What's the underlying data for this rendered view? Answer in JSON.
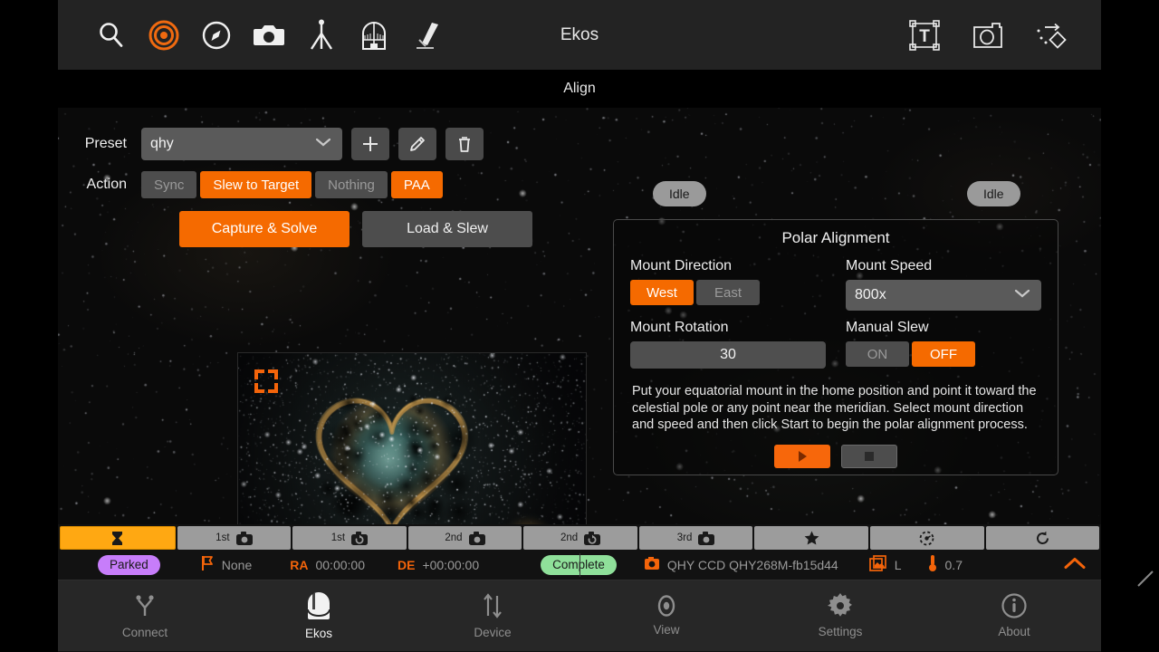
{
  "app": {
    "title": "Ekos",
    "page_title": "Align"
  },
  "toolbar": {
    "left_icons": [
      {
        "name": "search-icon",
        "label": "Search"
      },
      {
        "name": "target-icon",
        "label": "Target"
      },
      {
        "name": "compass-icon",
        "label": "Compass"
      },
      {
        "name": "camera-icon",
        "label": "Camera"
      },
      {
        "name": "tripod-icon",
        "label": "Mount"
      },
      {
        "name": "observatory-dome-icon",
        "label": "Observatory"
      },
      {
        "name": "telescope-icon",
        "label": "Telescope"
      }
    ],
    "right_icons": [
      {
        "name": "text-frame-icon",
        "label": "Text Overlay"
      },
      {
        "name": "photo-frame-icon",
        "label": "Photo"
      },
      {
        "name": "motion-diamond-icon",
        "label": "Motion"
      }
    ]
  },
  "align": {
    "preset_label": "Preset",
    "preset_value": "qhy",
    "preset_add_label": "+",
    "preset_edit_label": "Edit",
    "preset_delete_label": "Delete",
    "action_label": "Action",
    "action_buttons": [
      {
        "label": "Sync",
        "active": false
      },
      {
        "label": "Slew to Target",
        "active": true
      },
      {
        "label": "Nothing",
        "active": false
      },
      {
        "label": "PAA",
        "active": true
      }
    ],
    "capture_solve_label": "Capture & Solve",
    "load_slew_label": "Load & Slew",
    "preview_name": "solved-image-preview"
  },
  "status_badges": {
    "solver_state": "Idle",
    "capture_state": "Idle"
  },
  "polar_alignment": {
    "title": "Polar Alignment",
    "mount_direction_label": "Mount Direction",
    "mount_direction_options": [
      {
        "label": "West",
        "active": true
      },
      {
        "label": "East",
        "active": false
      }
    ],
    "mount_speed_label": "Mount Speed",
    "mount_speed_value": "800x",
    "mount_rotation_label": "Mount Rotation",
    "mount_rotation_value": "30",
    "manual_slew_label": "Manual Slew",
    "manual_slew_options": [
      {
        "label": "ON",
        "active": false
      },
      {
        "label": "OFF",
        "active": true
      }
    ],
    "help_text": "Put your equatorial mount in the home position and point it toward the celestial pole or any point near the meridian. Select mount direction and speed and then click Start to begin the polar alignment process.",
    "start_label": "Start",
    "stop_label": "Stop"
  },
  "module_tabs": [
    {
      "prefix": "",
      "icon": "hourglass-icon",
      "active": true
    },
    {
      "prefix": "1st",
      "icon": "camera-icon",
      "active": false
    },
    {
      "prefix": "1st",
      "icon": "camera-rotate-icon",
      "active": false
    },
    {
      "prefix": "2nd",
      "icon": "camera-icon",
      "active": false
    },
    {
      "prefix": "2nd",
      "icon": "camera-rotate-icon",
      "active": false
    },
    {
      "prefix": "3rd",
      "icon": "camera-icon",
      "active": false
    },
    {
      "prefix": "",
      "icon": "star-icon",
      "active": false
    },
    {
      "prefix": "",
      "icon": "dashed-circle-icon",
      "active": false
    },
    {
      "prefix": "",
      "icon": "refresh-icon",
      "active": false
    }
  ],
  "status_bar": {
    "mount_state": "Parked",
    "target_icon": "flag-icon",
    "target_name": "None",
    "ra_key": "RA",
    "ra_value": "00:00:00",
    "de_key": "DE",
    "de_value": "+00:00:00",
    "capture_state": "Complete",
    "camera_icon": "camera-icon",
    "camera_name": "QHY CCD QHY268M-fb15d44",
    "filter_icon": "images-icon",
    "filter_value": "L",
    "temperature_icon": "thermometer-icon",
    "temperature_value": "0.7",
    "collapse_icon": "chevron-up-icon"
  },
  "bottom_nav": [
    {
      "label": "Connect",
      "icon": "connect-icon",
      "active": false
    },
    {
      "label": "Ekos",
      "icon": "ekos-dome-icon",
      "active": true
    },
    {
      "label": "Device",
      "icon": "updown-arrows-icon",
      "active": false
    },
    {
      "label": "View",
      "icon": "eye-icon",
      "active": false
    },
    {
      "label": "Settings",
      "icon": "gear-icon",
      "active": false
    },
    {
      "label": "About",
      "icon": "info-icon",
      "active": false
    }
  ],
  "colors": {
    "accent_orange": "#f56a00",
    "toolbar_bg": "#232323",
    "panel_bg": "#0a0a0a",
    "tab_active": "#ffa812",
    "parked_pill": "#c77dfa",
    "complete_pill": "#8fe09a"
  }
}
